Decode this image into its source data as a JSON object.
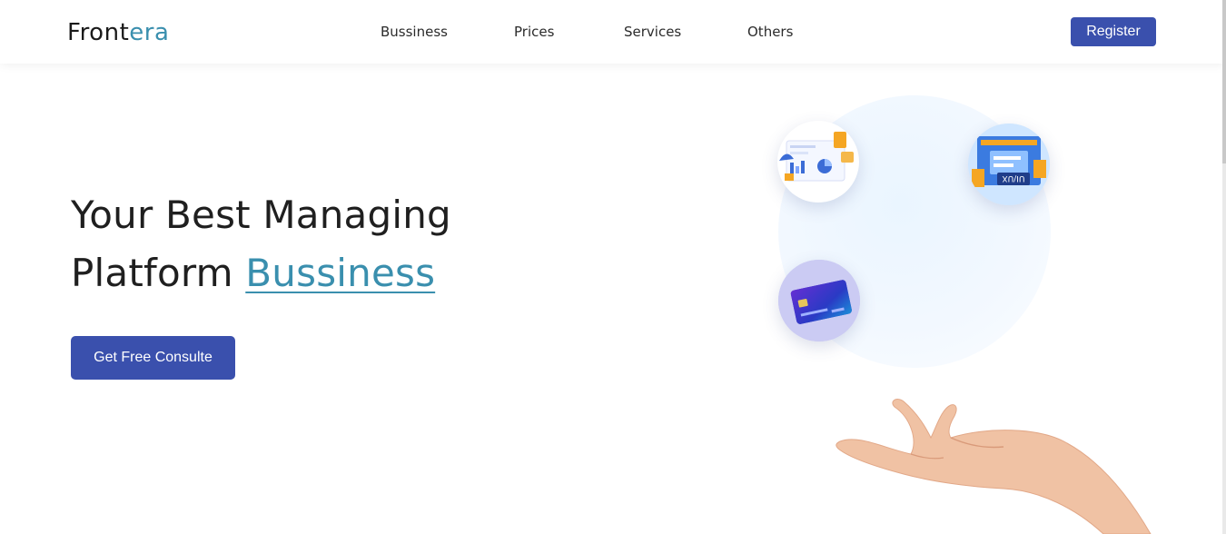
{
  "brand": {
    "name_part1": "Front",
    "name_part2": "era"
  },
  "nav": {
    "items": [
      {
        "label": "Bussiness"
      },
      {
        "label": "Prices"
      },
      {
        "label": "Services"
      },
      {
        "label": "Others"
      }
    ],
    "register_label": "Register"
  },
  "hero": {
    "title_line1": "Your Best Managing",
    "title_line2_prefix": "Platform ",
    "title_highlight": "Bussiness",
    "cta_label": "Get Free Consulte"
  },
  "illustration": {
    "tiles": [
      "dashboard-illustration",
      "ui-ux-illustration",
      "credit-card-illustration"
    ],
    "card_text": "UI/UX"
  },
  "colors": {
    "primary": "#3a50ad",
    "accent": "#3a8fae",
    "text": "#1f1f1f"
  }
}
